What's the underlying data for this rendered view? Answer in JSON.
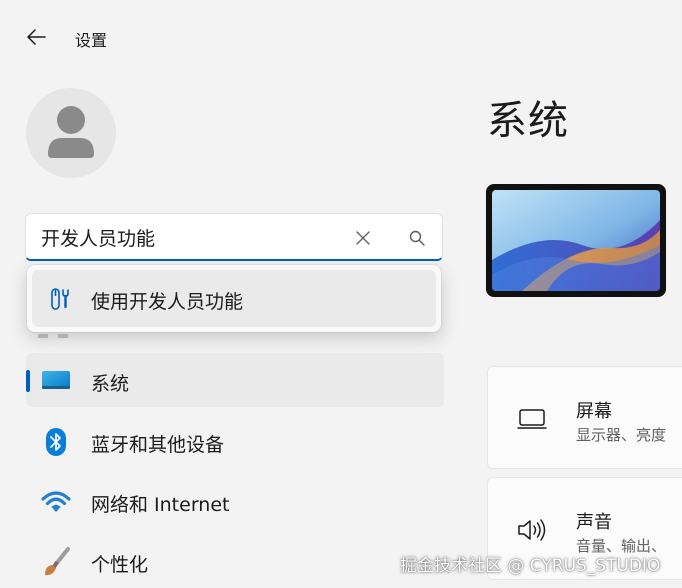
{
  "app": {
    "title": "设置"
  },
  "search": {
    "value": "开发人员功能",
    "clear_icon": "close-icon",
    "search_icon": "search-icon",
    "suggestions": [
      {
        "label": "使用开发人员功能",
        "icon": "developer-tools-icon"
      }
    ]
  },
  "sidebar": {
    "items": [
      {
        "label": "系统",
        "icon": "monitor-icon",
        "selected": true
      },
      {
        "label": "蓝牙和其他设备",
        "icon": "bluetooth-icon",
        "selected": false
      },
      {
        "label": "网络和 Internet",
        "icon": "wifi-icon",
        "selected": false
      },
      {
        "label": "个性化",
        "icon": "paintbrush-icon",
        "selected": false
      }
    ]
  },
  "main": {
    "title": "系统",
    "cards": [
      {
        "title": "屏幕",
        "subtitle": "显示器、亮度",
        "icon": "display-icon"
      },
      {
        "title": "声音",
        "subtitle": "音量、输出、",
        "icon": "speaker-icon"
      }
    ]
  },
  "watermark": "掘金技术社区 @ CYRUS_STUDIO",
  "colors": {
    "accent": "#005fb8",
    "background": "#f3f3f3"
  }
}
